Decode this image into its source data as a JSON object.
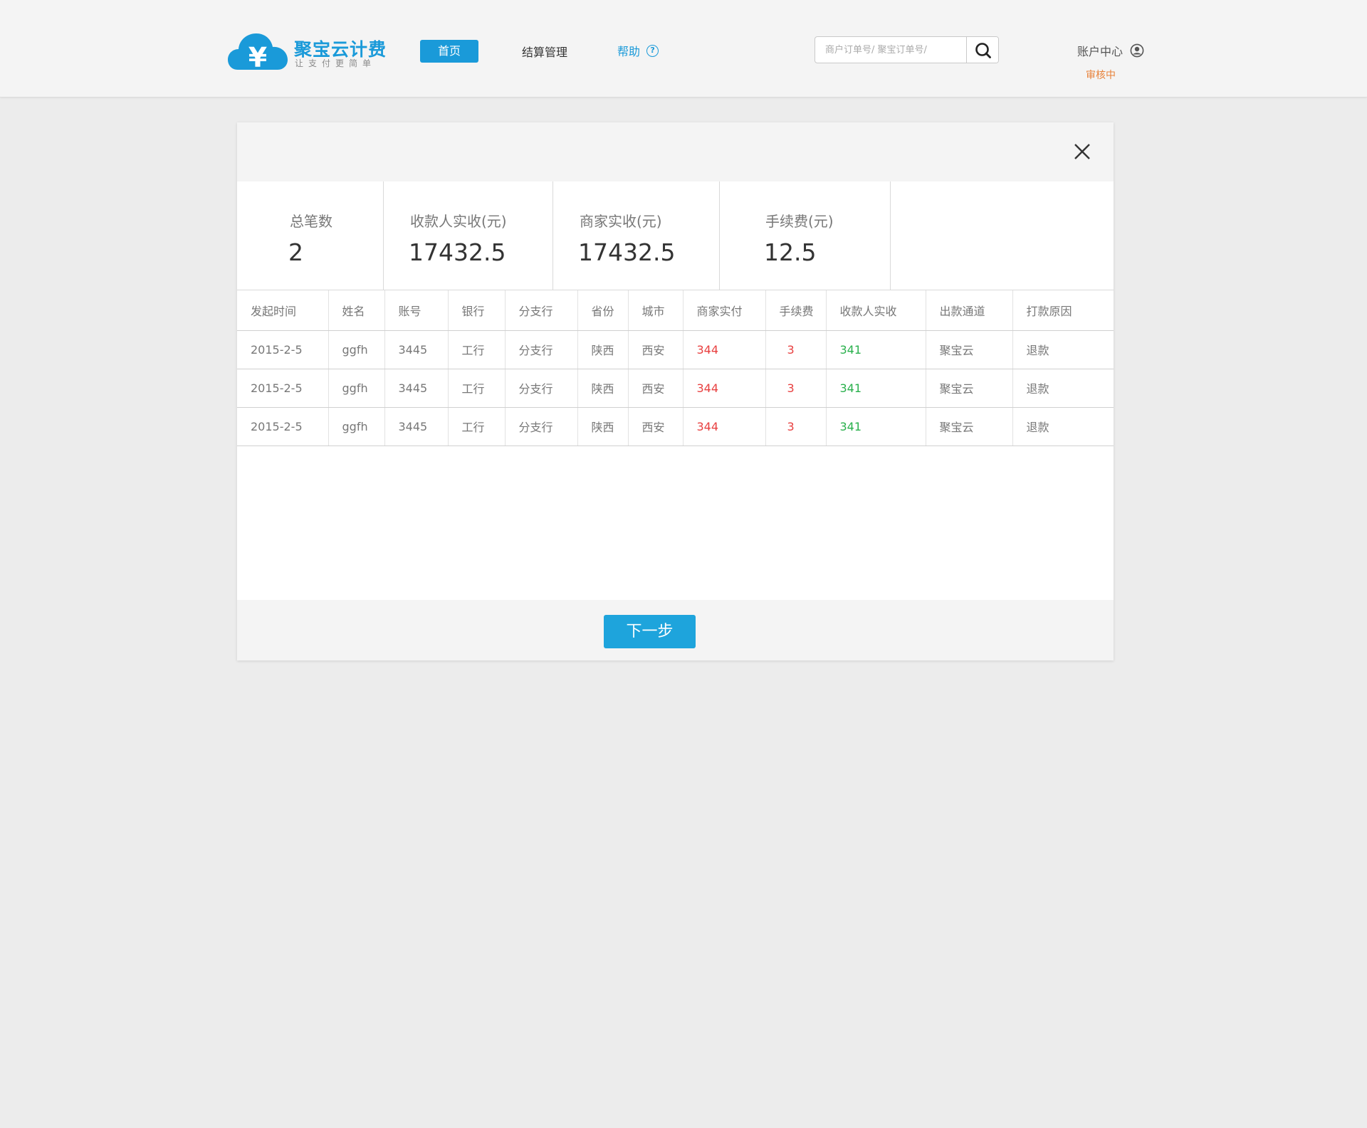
{
  "brand": {
    "name": "聚宝云计费",
    "slogan": "让支付更简单",
    "color": "#1a9ad9"
  },
  "nav": {
    "home": "首页",
    "settlement": "结算管理",
    "help": "帮助",
    "help_icon": "?"
  },
  "search": {
    "placeholder": "商户订单号/ 聚宝订单号/",
    "value": ""
  },
  "account": {
    "label": "账户中心",
    "status": "审核中",
    "status_color": "#e8823a"
  },
  "summary": {
    "total_count_label": "总笔数",
    "total_count": "2",
    "payee_received_label": "收款人实收(元)",
    "payee_received": "17432.5",
    "merchant_received_label": "商家实收(元)",
    "merchant_received": "17432.5",
    "fee_label": "手续费(元)",
    "fee": "12.5"
  },
  "table": {
    "columns": [
      "发起时间",
      "姓名",
      "账号",
      "银行",
      "分支行",
      "省份",
      "城市",
      "商家实付",
      "手续费",
      "收款人实收",
      "出款通道",
      "打款原因"
    ],
    "rows": [
      [
        "2015-2-5",
        "ggfh",
        "3445",
        "工行",
        "分支行",
        "陕西",
        "西安",
        "344",
        "3",
        "341",
        "聚宝云",
        "退款"
      ],
      [
        "2015-2-5",
        "ggfh",
        "3445",
        "工行",
        "分支行",
        "陕西",
        "西安",
        "344",
        "3",
        "341",
        "聚宝云",
        "退款"
      ],
      [
        "2015-2-5",
        "ggfh",
        "3445",
        "工行",
        "分支行",
        "陕西",
        "西安",
        "344",
        "3",
        "341",
        "聚宝云",
        "退款"
      ]
    ]
  },
  "footer": {
    "next_label": "下一步"
  }
}
